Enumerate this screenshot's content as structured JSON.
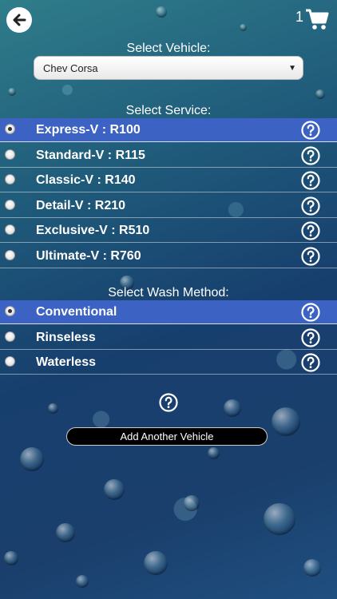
{
  "header": {
    "cart_count": "1"
  },
  "vehicle": {
    "label": "Select Vehicle:",
    "selected": "Chev Corsa"
  },
  "service": {
    "label": "Select Service:",
    "options": [
      {
        "label": "Express-V : R100",
        "selected": true
      },
      {
        "label": "Standard-V : R115",
        "selected": false
      },
      {
        "label": "Classic-V : R140",
        "selected": false
      },
      {
        "label": "Detail-V : R210",
        "selected": false
      },
      {
        "label": "Exclusive-V : R510",
        "selected": false
      },
      {
        "label": "Ultimate-V : R760",
        "selected": false
      }
    ]
  },
  "wash": {
    "label": "Select Wash Method:",
    "options": [
      {
        "label": "Conventional",
        "selected": true
      },
      {
        "label": "Rinseless",
        "selected": false
      },
      {
        "label": "Waterless",
        "selected": false
      }
    ]
  },
  "add_vehicle_label": "Add Another Vehicle",
  "colors": {
    "selected_row": "#3c63c4",
    "background": "#1f4f7a"
  }
}
